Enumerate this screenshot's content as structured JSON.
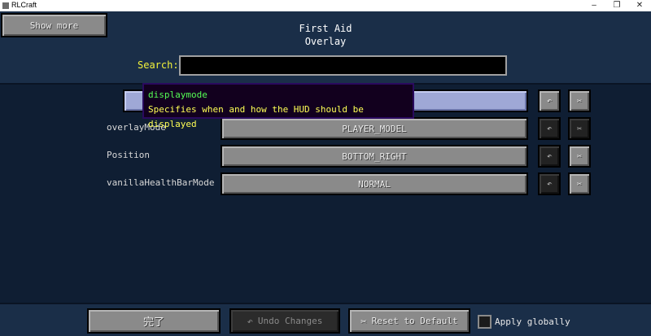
{
  "window": {
    "title": "RLCraft",
    "minimize": "–",
    "restore": "❐",
    "close": "✕"
  },
  "header": {
    "show_more": "Show more",
    "title_line1": "First Aid",
    "title_line2": "Overlay",
    "search_label": "Search:",
    "search_value": ""
  },
  "tooltip": {
    "name": "displaymode",
    "description": "Specifies when and how the HUD should be displayed"
  },
  "rows": [
    {
      "label": "",
      "value": ""
    },
    {
      "label": "overlayMode",
      "value": "PLAYER_MODEL"
    },
    {
      "label": "Position",
      "value": "BOTTOM_RIGHT"
    },
    {
      "label": "vanillaHealthBarMode",
      "value": "NORMAL"
    }
  ],
  "row_icons": {
    "undo": "↶",
    "reset": "✂"
  },
  "footer": {
    "done": "完了",
    "undo_changes": "Undo Changes",
    "reset_default": "Reset to Default",
    "apply_globally": "Apply globally"
  }
}
